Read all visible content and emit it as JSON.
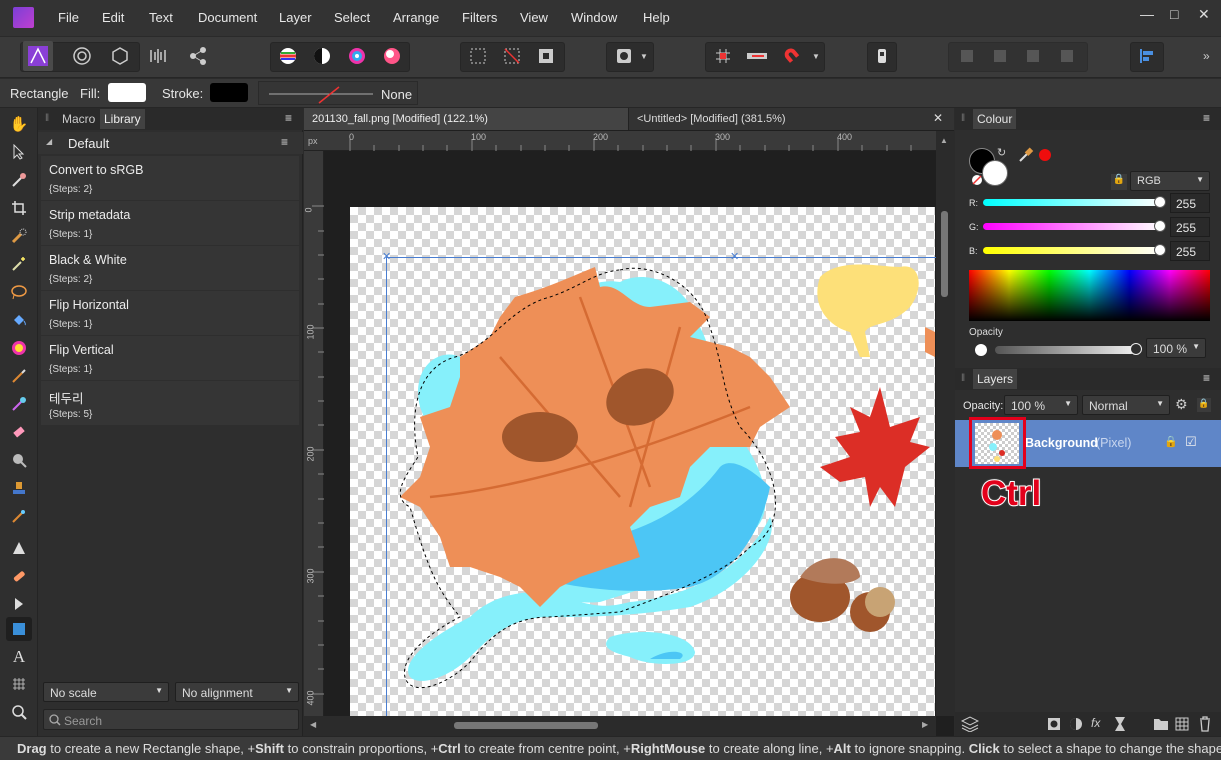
{
  "menubar": {
    "items": [
      "File",
      "Edit",
      "Text",
      "Document",
      "Layer",
      "Select",
      "Arrange",
      "Filters",
      "View",
      "Window",
      "Help"
    ]
  },
  "context_toolbar": {
    "tool_name": "Rectangle",
    "fill_label": "Fill:",
    "stroke_label": "Stroke:",
    "stroke_style": "None",
    "fill_color": "#ffffff",
    "stroke_color": "#000000"
  },
  "left_panel": {
    "tabs": [
      "Macro",
      "Library"
    ],
    "active_tab": "Library",
    "category": "Default",
    "macros": [
      {
        "title": "Convert to sRGB",
        "steps": "{Steps: 2}"
      },
      {
        "title": "Strip metadata",
        "steps": "{Steps: 1}"
      },
      {
        "title": "Black & White",
        "steps": "{Steps: 2}"
      },
      {
        "title": "Flip Horizontal",
        "steps": "{Steps: 1}"
      },
      {
        "title": "Flip Vertical",
        "steps": "{Steps: 1}"
      },
      {
        "title": "테두리",
        "steps": "{Steps: 5}"
      }
    ],
    "scale_select": "No scale",
    "alignment_select": "No alignment",
    "search_placeholder": "Search"
  },
  "document_tabs": [
    {
      "label": "201130_fall.png [Modified] (122.1%)"
    },
    {
      "label": "<Untitled> [Modified] (381.5%)"
    }
  ],
  "rulers": {
    "unit": "px",
    "h_ticks": [
      "0",
      "100",
      "200",
      "300",
      "400"
    ],
    "v_ticks": [
      "0",
      "100",
      "200",
      "300",
      "400"
    ]
  },
  "colour_panel": {
    "title": "Colour",
    "model": "RGB",
    "r_label": "R:",
    "g_label": "G:",
    "b_label": "B:",
    "r": "255",
    "g": "255",
    "b": "255",
    "opacity_label": "Opacity",
    "opacity": "100 %"
  },
  "layers_panel": {
    "title": "Layers",
    "opacity_label": "Opacity:",
    "opacity": "100 %",
    "blend_mode": "Normal",
    "layer_name": "Background",
    "layer_type": "(Pixel)"
  },
  "annotation": {
    "text": "Ctrl"
  },
  "status_bar": {
    "segments": [
      {
        "bold": "Drag",
        "text": " to create a new Rectangle shape, +"
      },
      {
        "bold": "Shift",
        "text": " to constrain proportions, +"
      },
      {
        "bold": "Ctrl",
        "text": " to create from centre point, +"
      },
      {
        "bold": "RightMouse",
        "text": " to create along line, +"
      },
      {
        "bold": "Alt",
        "text": " to ignore snapping. "
      },
      {
        "bold": "Click",
        "text": " to select a shape to change the shape's p"
      }
    ]
  }
}
